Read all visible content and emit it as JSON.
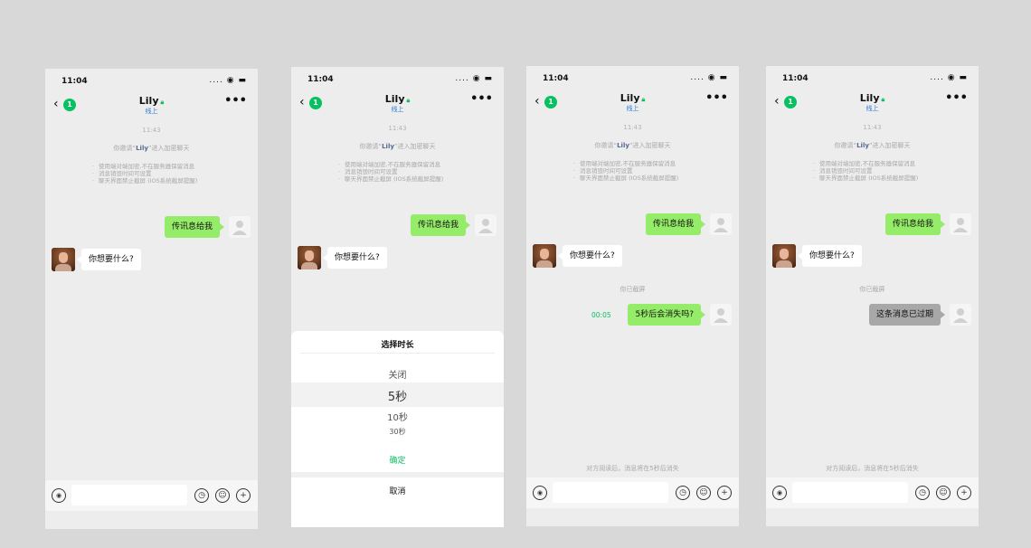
{
  "colors": {
    "page_bg": "#d8d8d8",
    "chat_bg": "#ededed",
    "accent": "#07c160",
    "sent_bubble": "#95ec69",
    "expired_bubble": "#a8a8a8",
    "link": "#576b95"
  },
  "status": {
    "time": "11:04",
    "signal": "....",
    "wifi_icon": "wifi-icon",
    "battery_icon": "battery-icon"
  },
  "nav": {
    "back_icon": "chevron-left-icon",
    "unread": "1",
    "name": "Lily",
    "lock_icon": "lock-icon",
    "subtitle": "线上",
    "more": "•••"
  },
  "chat": {
    "timestamp": "11:43",
    "invite_pre": "你邀请“",
    "invite_name": "Lily",
    "invite_post": "”进入加密聊天",
    "tips": [
      "使用端对端加密,不在服务器保留消息",
      "消息销毁时间可设置",
      "聊天界面禁止截屏 (IOS系统截屏提醒)"
    ],
    "sent_msg": "传讯息给我",
    "recv_msg": "你想要什么?",
    "screenshot_notice": "你已截屏",
    "timer": "00:05",
    "timed_msg": "5秒后会消失吗?",
    "expired_msg": "这条消息已过期",
    "read_notice": "对方阅读后，消息将在5秒后消失"
  },
  "picker": {
    "title": "选择时长",
    "options": [
      "关闭",
      "5秒",
      "10秒",
      "30秒"
    ],
    "selected": "5秒",
    "confirm": "确定",
    "cancel": "取消"
  },
  "input": {
    "voice_icon": "voice-icon",
    "timer_icon": "clock-icon",
    "emoji_icon": "emoji-icon",
    "plus_icon": "plus-icon"
  }
}
